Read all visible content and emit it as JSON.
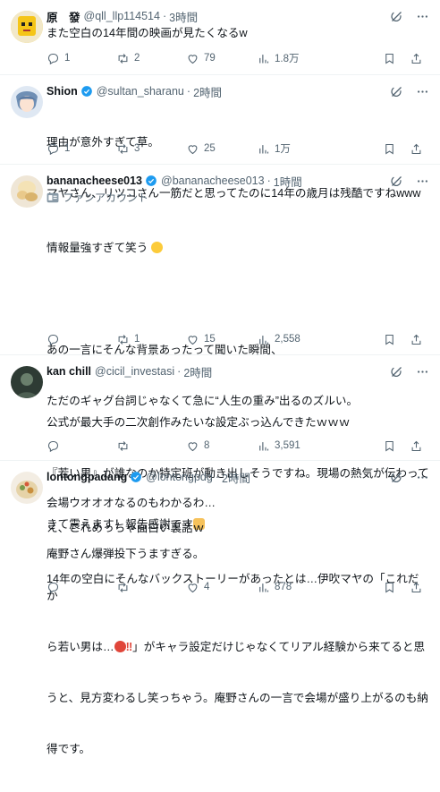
{
  "tweets": [
    {
      "name": "原　發",
      "handle": "@qll_llp114514",
      "time": "3時間",
      "lines": [
        "また空白の14年間の映画が見たくなるw"
      ],
      "replies": "1",
      "retweets": "2",
      "likes": "79",
      "views": "1.8万"
    },
    {
      "name": "Shion",
      "handle": "@sultan_sharanu",
      "time": "2時間",
      "lines": [
        "理由が意外すぎて草。",
        "マヤさん、リツコさん一筋だと思ってたのに14年の歳月は残酷ですねwww"
      ],
      "replies": "1",
      "retweets": "3",
      "likes": "25",
      "views": "1万"
    },
    {
      "name": "bananacheese013",
      "handle": "@bananacheese013",
      "time": "1時間",
      "subline": "ファンアカウント",
      "lines": [
        "情報量強すぎて笑う",
        "",
        "あの一言にそんな背景あったって聞いた瞬間、",
        "ただのギャグ台詞じゃなくて急に“人生の重み”出るのズルい。",
        "",
        "会場ウオオオなるのもわかるわ…",
        "庵野さん爆弾投下うますぎる。"
      ],
      "replies": "",
      "retweets": "1",
      "likes": "15",
      "views": "2,558"
    },
    {
      "name": "kan chill",
      "handle": "@cicil_investasi",
      "time": "2時間",
      "lines": [
        "公式が最大手の二次創作みたいな設定ぶっ込んできたｗｗｗ",
        "『若い男』が誰なのか特定班が動き出しそうですね。現場の熱気が伝わって",
        "きて震えます！報告感謝です"
      ],
      "replies": "",
      "retweets": "",
      "likes": "8",
      "views": "3,591"
    },
    {
      "name": "lontongpadang",
      "handle": "@lontongpdg",
      "time": "2時間",
      "lines": [
        "え、これめっちゃ面白い裏話ｗ",
        "14年の空白にそんなバックストーリーがあったとは…伊吹マヤの「これだか",
        "ら若い男は…",
        "」がキャラ設定だけじゃなくてリアル経験から来てると思",
        "うと、見方変わるし笑っちゃう。庵野さんの一言で会場が盛り上がるのも納",
        "得です。"
      ],
      "replies": "",
      "retweets": "",
      "likes": "4",
      "views": "878"
    }
  ],
  "colors": {
    "text": "#0f1419",
    "muted": "#536471",
    "verified": "#1d9bf0",
    "border": "#eff3f4"
  },
  "icons": [
    "reply-icon",
    "retweet-icon",
    "like-icon",
    "views-icon",
    "bookmark-icon",
    "share-icon",
    "grok-icon",
    "more-icon",
    "verified-badge-icon",
    "fan-account-icon"
  ]
}
